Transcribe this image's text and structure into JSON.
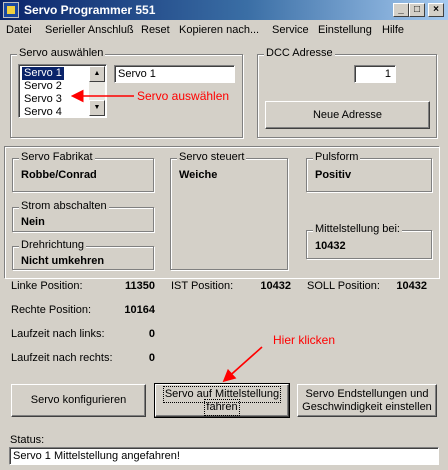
{
  "window": {
    "title": "Servo Programmer 551"
  },
  "titlebar_buttons": {
    "minimize": "_",
    "maximize": "□",
    "close": "×"
  },
  "menu": [
    "Datei",
    "Serieller Anschluß",
    "Reset",
    "Kopieren nach...",
    "Service",
    "Einstellung",
    "Hilfe"
  ],
  "servo_select": {
    "legend": "Servo auswählen",
    "items": [
      "Servo 1",
      "Servo 2",
      "Servo 3",
      "Servo 4"
    ],
    "selected_index": 0,
    "name_value": "Servo 1",
    "annotation": "Servo auswählen"
  },
  "dcc": {
    "legend": "DCC Adresse",
    "value": "1",
    "button": "Neue Adresse"
  },
  "info": {
    "fabrikat": {
      "label": "Servo Fabrikat",
      "value": "Robbe/Conrad"
    },
    "strom": {
      "label": "Strom abschalten",
      "value": "Nein"
    },
    "drehrichtung": {
      "label": "Drehrichtung",
      "value": "Nicht umkehren"
    },
    "steuert": {
      "label": "Servo steuert",
      "value": "Weiche"
    },
    "pulsform": {
      "label": "Pulsform",
      "value": "Positiv"
    },
    "mittelstellung": {
      "label": "Mittelstellung bei:",
      "value": "10432"
    }
  },
  "positions": {
    "linke_label": "Linke Position:",
    "linke_value": "11350",
    "rechte_label": "Rechte Position:",
    "rechte_value": "10164",
    "ist_label": "IST Position:",
    "ist_value": "10432",
    "soll_label": "SOLL Position:",
    "soll_value": "10432",
    "laufzeit_links_label": "Laufzeit nach links:",
    "laufzeit_links_value": "0",
    "laufzeit_rechts_label": "Laufzeit nach rechts:",
    "laufzeit_rechts_value": "0"
  },
  "buttons": {
    "konfigurieren": "Servo konfigurieren",
    "mittelstellung_line1": "Servo auf Mittelstellung",
    "mittelstellung_line2": "fahren",
    "endstellungen_line1": "Servo Endstellungen und",
    "endstellungen_line2": "Geschwindigkeit einstellen"
  },
  "annotation_click": "Hier klicken",
  "status": {
    "label": "Status:",
    "value": "Servo 1 Mittelstellung angefahren!"
  },
  "colors": {
    "titlebar": "#0a246a",
    "annotation": "#ff0000",
    "face": "#d4d0c8",
    "selection": "#0a246a"
  }
}
